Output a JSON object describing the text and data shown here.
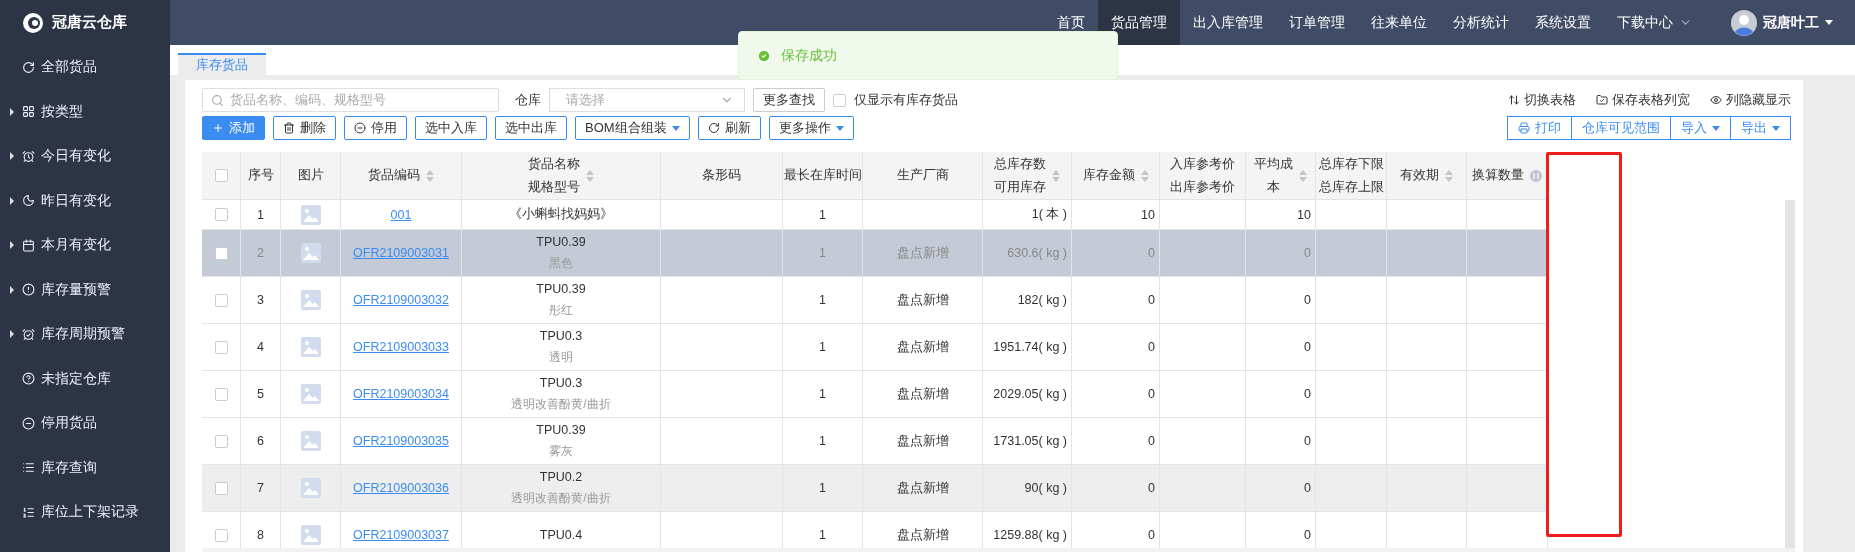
{
  "brand": "冠唐云仓库",
  "nav": [
    {
      "label": "首页",
      "selected": false
    },
    {
      "label": "货品管理",
      "selected": true
    },
    {
      "label": "出入库管理",
      "selected": false
    },
    {
      "label": "订单管理",
      "selected": false
    },
    {
      "label": "往来单位",
      "selected": false
    },
    {
      "label": "分析统计",
      "selected": false
    },
    {
      "label": "系统设置",
      "selected": false
    },
    {
      "label": "下载中心",
      "selected": false,
      "dropdown": true
    }
  ],
  "user": {
    "name": "冠唐叶工"
  },
  "toast": {
    "message": "保存成功"
  },
  "sidebar": {
    "items": [
      {
        "label": "全部货品",
        "expandable": false
      },
      {
        "label": "按类型",
        "expandable": true
      },
      {
        "label": "今日有变化",
        "expandable": true
      },
      {
        "label": "昨日有变化",
        "expandable": true
      },
      {
        "label": "本月有变化",
        "expandable": true
      },
      {
        "label": "库存量预警",
        "expandable": true
      },
      {
        "label": "库存周期预警",
        "expandable": true
      },
      {
        "label": "未指定仓库",
        "expandable": false
      },
      {
        "label": "停用货品",
        "expandable": false
      },
      {
        "label": "库存查询",
        "expandable": false
      },
      {
        "label": "库位上下架记录",
        "expandable": false
      }
    ]
  },
  "tabs": [
    {
      "label": "库存货品",
      "selected": true
    }
  ],
  "filters": {
    "search": {
      "placeholder": "货品名称、编码、规格型号"
    },
    "warehouse": {
      "label": "仓库",
      "placeholder": "请选择"
    },
    "more_search": "更多查找",
    "in_stock_only": {
      "label": "仅显示有库存货品",
      "checked": false
    }
  },
  "view_actions": [
    "切换表格",
    "保存表格列宽",
    "列隐藏显示"
  ],
  "actions": [
    {
      "label": "添加",
      "primary": true,
      "dropdown": false
    },
    {
      "label": "删除",
      "primary": false,
      "dropdown": false
    },
    {
      "label": "停用",
      "primary": false,
      "dropdown": false
    },
    {
      "label": "选中入库",
      "primary": false,
      "dropdown": false
    },
    {
      "label": "选中出库",
      "primary": false,
      "dropdown": false
    },
    {
      "label": "BOM组合组装",
      "primary": false,
      "dropdown": true
    },
    {
      "label": "刷新",
      "primary": false,
      "dropdown": false
    },
    {
      "label": "更多操作",
      "primary": false,
      "dropdown": true
    }
  ],
  "right_actions": [
    {
      "label": "打印",
      "dropdown": false
    },
    {
      "label": "仓库可见范围",
      "dropdown": false
    },
    {
      "label": "导入",
      "dropdown": true
    },
    {
      "label": "导出",
      "dropdown": true
    }
  ],
  "table": {
    "select_all": {
      "checked": false
    },
    "columns": [
      {
        "kind": "check",
        "sortable": false
      },
      {
        "kind": "text",
        "lines": [
          "序号"
        ],
        "sortable": false
      },
      {
        "kind": "text",
        "lines": [
          "图片"
        ],
        "sortable": false
      },
      {
        "kind": "text",
        "lines": [
          "货品编码"
        ],
        "sortable": true
      },
      {
        "kind": "text",
        "lines": [
          "货品名称",
          "规格型号"
        ],
        "sortable": true
      },
      {
        "kind": "text",
        "lines": [
          "条形码"
        ],
        "sortable": false
      },
      {
        "kind": "text",
        "lines": [
          "最长在库时间"
        ],
        "sortable": false
      },
      {
        "kind": "text",
        "lines": [
          "生产厂商"
        ],
        "sortable": false
      },
      {
        "kind": "text",
        "lines": [
          "总库存数",
          "可用库存"
        ],
        "sortable": true
      },
      {
        "kind": "text",
        "lines": [
          "库存金额"
        ],
        "sortable": true
      },
      {
        "kind": "text",
        "lines": [
          "入库参考价",
          "出库参考价"
        ],
        "sortable": false
      },
      {
        "kind": "text",
        "lines": [
          "平均成",
          "本"
        ],
        "sortable": true
      },
      {
        "kind": "text",
        "lines": [
          "总库存下限",
          "总库存上限"
        ],
        "sortable": false
      },
      {
        "kind": "text",
        "lines": [
          "有效期"
        ],
        "sortable": true
      },
      {
        "kind": "info",
        "lines": [
          "换算数量"
        ],
        "sortable": false
      }
    ],
    "rows": [
      {
        "index": "1",
        "code": "001",
        "name": "《小蝌蚪找妈妈》",
        "max_days": "1",
        "stock": "1( 本 )",
        "amount": "10",
        "avg_cost": "10",
        "selected": false,
        "hover": false
      },
      {
        "index": "2",
        "code": "OFR2109003031",
        "name": "TPU0.39",
        "spec": "黑色",
        "max_days": "1",
        "maker": "盘点新增",
        "stock": "630.6( kg )",
        "amount": "0",
        "avg_cost": "0",
        "selected": true,
        "hover": false
      },
      {
        "index": "3",
        "code": "OFR2109003032",
        "name": "TPU0.39",
        "spec": "彤红",
        "max_days": "1",
        "maker": "盘点新增",
        "stock": "182( kg )",
        "amount": "0",
        "avg_cost": "0",
        "selected": false,
        "hover": false
      },
      {
        "index": "4",
        "code": "OFR2109003033",
        "name": "TPU0.3",
        "spec": "透明",
        "max_days": "1",
        "maker": "盘点新增",
        "stock": "1951.74( kg )",
        "amount": "0",
        "avg_cost": "0",
        "selected": false,
        "hover": false
      },
      {
        "index": "5",
        "code": "OFR2109003034",
        "name": "TPU0.3",
        "spec": "透明改善酚黄/曲折",
        "max_days": "1",
        "maker": "盘点新增",
        "stock": "2029.05( kg )",
        "amount": "0",
        "avg_cost": "0",
        "selected": false,
        "hover": false
      },
      {
        "index": "6",
        "code": "OFR2109003035",
        "name": "TPU0.39",
        "spec": "雾灰",
        "max_days": "1",
        "maker": "盘点新增",
        "stock": "1731.05( kg )",
        "amount": "0",
        "avg_cost": "0",
        "selected": false,
        "hover": false
      },
      {
        "index": "7",
        "code": "OFR2109003036",
        "name": "TPU0.2",
        "spec": "透明改善酚黄/曲折",
        "max_days": "1",
        "maker": "盘点新增",
        "stock": "90( kg )",
        "amount": "0",
        "avg_cost": "0",
        "selected": false,
        "hover": true
      },
      {
        "index": "8",
        "code": "OFR2109003037",
        "name": "TPU0.4",
        "max_days": "1",
        "maker": "盘点新增",
        "stock": "1259.88( kg )",
        "amount": "0",
        "avg_cost": "0",
        "selected": false,
        "hover": false
      }
    ]
  }
}
